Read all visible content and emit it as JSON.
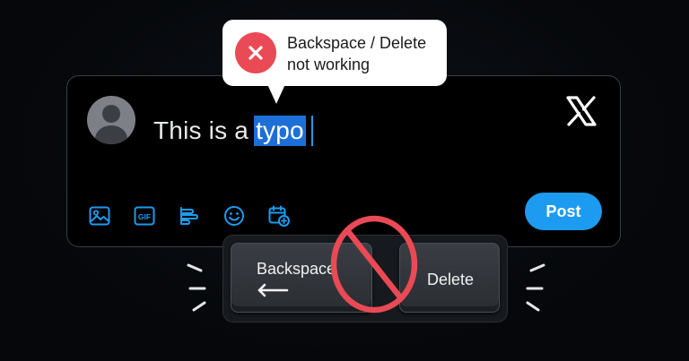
{
  "tooltip": {
    "line1": "Backspace / Delete",
    "line2": "not working",
    "icon": "error-x-icon",
    "icon_color": "#ea4a55"
  },
  "composer": {
    "text_prefix": "This is a",
    "selected_word": "typo",
    "post_label": "Post",
    "brand_logo": "x-logo-icon",
    "toolbar_icons": [
      "image-icon",
      "gif-icon",
      "poll-icon",
      "emoji-icon",
      "schedule-icon"
    ],
    "gif_label": "GIF"
  },
  "keys": {
    "backspace_label": "Backspace",
    "delete_label": "Delete"
  },
  "colors": {
    "accent": "#1d9bf0",
    "selection": "#1d6fd8",
    "error": "#ea4a55",
    "background": "#05070a"
  }
}
